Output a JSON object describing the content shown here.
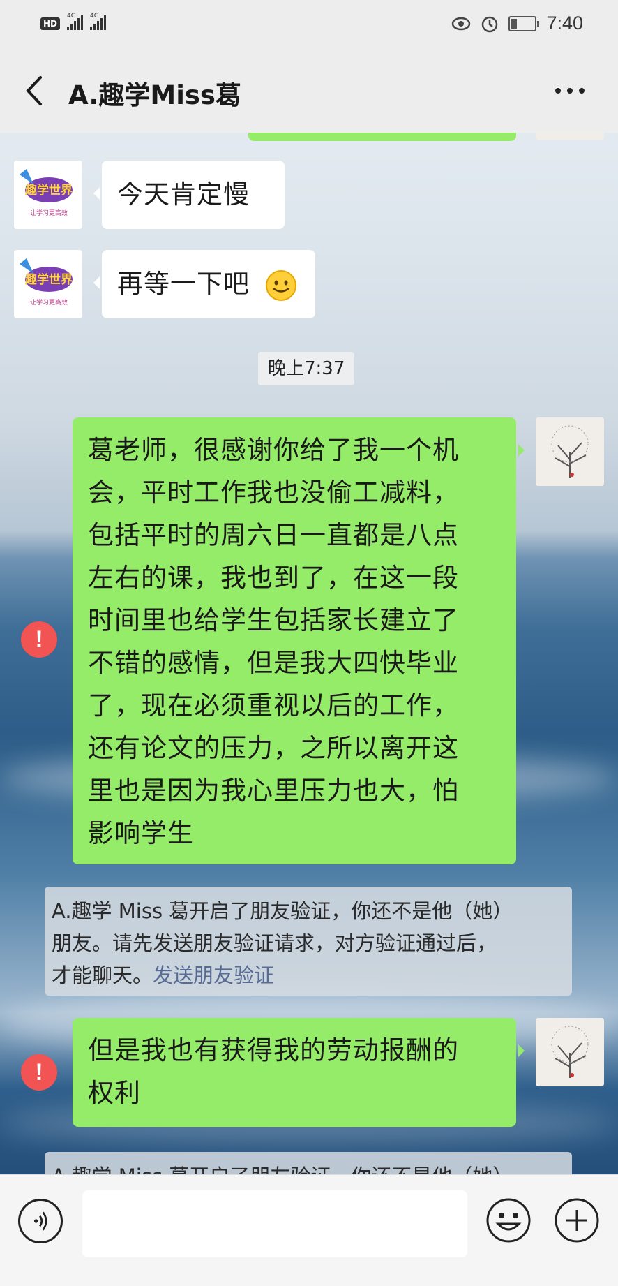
{
  "status_bar": {
    "hd": "HD",
    "net1": "4G",
    "net2": "4G",
    "time": "7:40"
  },
  "header": {
    "title": "A.趣学Miss葛"
  },
  "messages": [
    {
      "side": "left",
      "text": "今天肯定慢"
    },
    {
      "side": "left",
      "text": "再等一下吧"
    },
    {
      "type": "time",
      "text": "晚上7:37"
    },
    {
      "side": "right",
      "failed": true,
      "lines": [
        "葛老师，很感谢你给了我一个机",
        "会，平时工作我也没偷工减料，",
        "包括平时的周六日一直都是八点",
        "左右的课，我也到了，在这一段",
        "时间里也给学生包括家长建立了",
        "不错的感情，但是我大四快毕业",
        "了，现在必须重视以后的工作，",
        "还有论文的压力，之所以离开这",
        "里也是因为我心里压力也大，怕",
        "影响学生"
      ]
    },
    {
      "type": "system",
      "lines": [
        "A.趣学 Miss 葛开启了朋友验证，你还不是他（她）",
        "朋友。请先发送朋友验证请求，对方验证通过后，"
      ],
      "last_prefix": "才能聊天。",
      "link": "发送朋友验证"
    },
    {
      "side": "right",
      "failed": true,
      "lines": [
        "但是我也有获得我的劳动报酬的",
        "权利"
      ]
    },
    {
      "type": "system_partial",
      "text": "A.趣学 Miss 葛开启了朋友验证，你还不是他（她）"
    }
  ],
  "avatar_logo": {
    "brand": "趣学世界",
    "tagline": "让学习更高效"
  },
  "error_mark": "!",
  "input": {
    "placeholder": ""
  },
  "colors": {
    "bubble_green": "#95ec69",
    "bubble_white": "#ffffff",
    "error_red": "#f25353",
    "link": "#576b95",
    "header_bg": "#ededed"
  },
  "icons": [
    "back-icon",
    "more-icon",
    "voice-icon",
    "emoji-icon",
    "plus-icon",
    "alarm-icon",
    "eye-icon",
    "battery-icon",
    "signal-icon"
  ]
}
